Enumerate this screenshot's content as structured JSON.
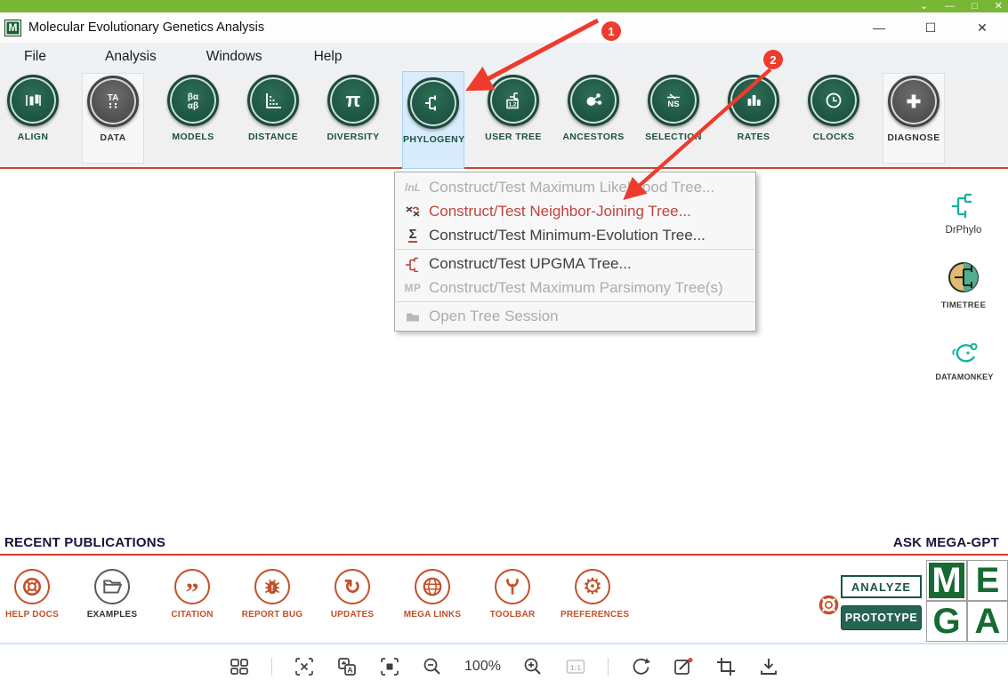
{
  "window": {
    "title": "Molecular Evolutionary Genetics Analysis",
    "app_initial": "M"
  },
  "menubar": {
    "items": [
      {
        "label": "File"
      },
      {
        "label": "Analysis"
      },
      {
        "label": "Windows"
      },
      {
        "label": "Help"
      }
    ]
  },
  "toolbar": {
    "buttons": [
      {
        "label": "ALIGN"
      },
      {
        "label": "DATA",
        "glyph": "TA"
      },
      {
        "label": "MODELS",
        "glyph_top": "βα",
        "glyph_bottom": "αβ"
      },
      {
        "label": "DISTANCE"
      },
      {
        "label": "DIVERSITY",
        "glyph": "π"
      },
      {
        "label": "PHYLOGENY"
      },
      {
        "label": "USER TREE",
        "glyph": "1,2"
      },
      {
        "label": "ANCESTORS"
      },
      {
        "label": "SELECTION",
        "glyph": "NS"
      },
      {
        "label": "RATES"
      },
      {
        "label": "CLOCKS"
      },
      {
        "label": "DIAGNOSE"
      }
    ]
  },
  "phylogeny_menu": {
    "items": [
      {
        "glyph": "lnL",
        "label": "Construct/Test Maximum Likelihood Tree..."
      },
      {
        "glyph": "",
        "label": "Construct/Test Neighbor-Joining Tree..."
      },
      {
        "glyph": "Σ",
        "label": "Construct/Test Minimum-Evolution Tree..."
      },
      {
        "glyph": "",
        "label": "Construct/Test UPGMA Tree..."
      },
      {
        "glyph": "MP",
        "label": "Construct/Test Maximum Parsimony Tree(s)"
      },
      {
        "glyph": "",
        "label": "Open Tree Session"
      }
    ]
  },
  "side_launchers": {
    "drphylo": "DrPhylo",
    "timetree": "TIMETREE",
    "datamonkey": "DATAMONKEY"
  },
  "publications": {
    "heading": "RECENT PUBLICATIONS",
    "ask_label": "ASK MEGA-GPT"
  },
  "footer": {
    "buttons": [
      {
        "label": "HELP DOCS"
      },
      {
        "label": "EXAMPLES"
      },
      {
        "label": "CITATION"
      },
      {
        "label": "REPORT BUG"
      },
      {
        "label": "UPDATES"
      },
      {
        "label": "MEGA LINKS"
      },
      {
        "label": "TOOLBAR"
      },
      {
        "label": "PREFERENCES"
      }
    ],
    "analyze_label": "ANALYZE",
    "prototype_label": "PROTOTYPE",
    "logo_letters": [
      "M",
      "E",
      "G",
      "A"
    ]
  },
  "viewer_bar": {
    "zoom_level": "100%",
    "ratio_label": "1:1"
  },
  "annotations": {
    "step1": "1",
    "step2": "2"
  },
  "colors": {
    "top_bar_green": "#77b735",
    "brand_green": "#1d5444",
    "accent_orange": "#c2512a",
    "annotation_red": "#ee3b2e",
    "menu_highlight_red": "#c0453c",
    "heading_navy": "#16163f",
    "separator_red": "#d93a2b",
    "phylogeny_highlight": "#d9ecfc"
  }
}
